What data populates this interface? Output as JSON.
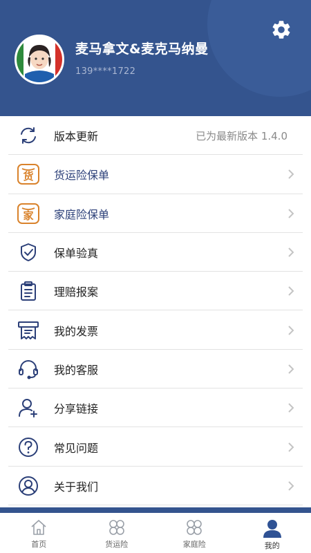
{
  "profile": {
    "name": "麦马拿文&麦克马纳曼",
    "phone": "139****1722"
  },
  "colors": {
    "header_bg": "#34548e",
    "accent_orange": "#d9822b",
    "icon_navy": "#2b3f78"
  },
  "icons": {
    "settings": "gear-icon"
  },
  "menu": [
    {
      "label": "版本更新",
      "value": "已为最新版本 1.4.0",
      "icon": "refresh-icon"
    },
    {
      "label": "货运险保单",
      "icon": "cargo-badge-icon",
      "badge": "货"
    },
    {
      "label": "家庭险保单",
      "icon": "home-badge-icon",
      "badge": "家"
    },
    {
      "label": "保单验真",
      "icon": "shield-check-icon"
    },
    {
      "label": "理赔报案",
      "icon": "clipboard-icon"
    },
    {
      "label": "我的发票",
      "icon": "invoice-icon"
    },
    {
      "label": "我的客服",
      "icon": "headset-icon"
    },
    {
      "label": "分享链接",
      "icon": "add-user-icon"
    },
    {
      "label": "常见问题",
      "icon": "question-icon"
    },
    {
      "label": "关于我们",
      "icon": "user-circle-icon"
    }
  ],
  "tabs": [
    {
      "label": "首页",
      "icon": "home-icon"
    },
    {
      "label": "货运险",
      "icon": "clover-icon"
    },
    {
      "label": "家庭险",
      "icon": "clover-icon"
    },
    {
      "label": "我的",
      "icon": "person-icon",
      "active": true
    }
  ]
}
